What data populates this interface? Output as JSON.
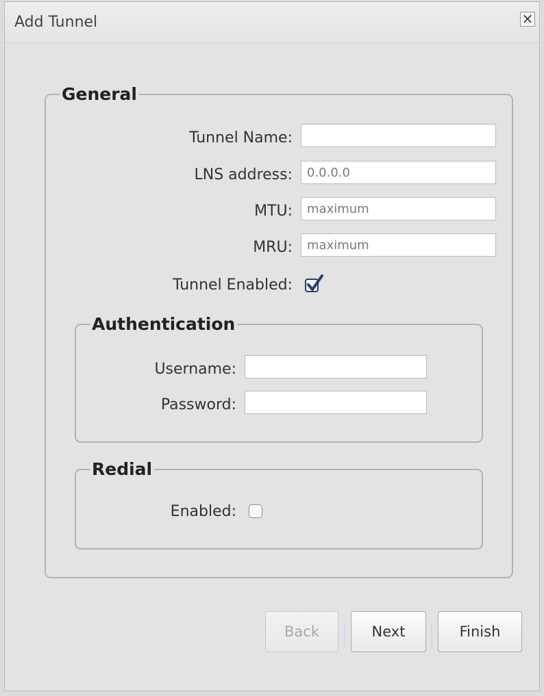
{
  "dialog": {
    "title": "Add Tunnel",
    "close_label": "×"
  },
  "general": {
    "legend": "General",
    "tunnel_name": {
      "label": "Tunnel Name:",
      "value": "",
      "placeholder": ""
    },
    "lns_address": {
      "label": "LNS address:",
      "value": "",
      "placeholder": "0.0.0.0"
    },
    "mtu": {
      "label": "MTU:",
      "value": "",
      "placeholder": "maximum"
    },
    "mru": {
      "label": "MRU:",
      "value": "",
      "placeholder": "maximum"
    },
    "tunnel_enabled": {
      "label": "Tunnel Enabled:",
      "checked": true
    }
  },
  "authentication": {
    "legend": "Authentication",
    "username": {
      "label": "Username:",
      "value": ""
    },
    "password": {
      "label": "Password:",
      "value": ""
    }
  },
  "redial": {
    "legend": "Redial",
    "enabled": {
      "label": "Enabled:",
      "checked": false
    }
  },
  "buttons": {
    "back": "Back",
    "next": "Next",
    "finish": "Finish"
  },
  "colors": {
    "accent": "#2a3f6e",
    "separator": "#c9dbee"
  }
}
